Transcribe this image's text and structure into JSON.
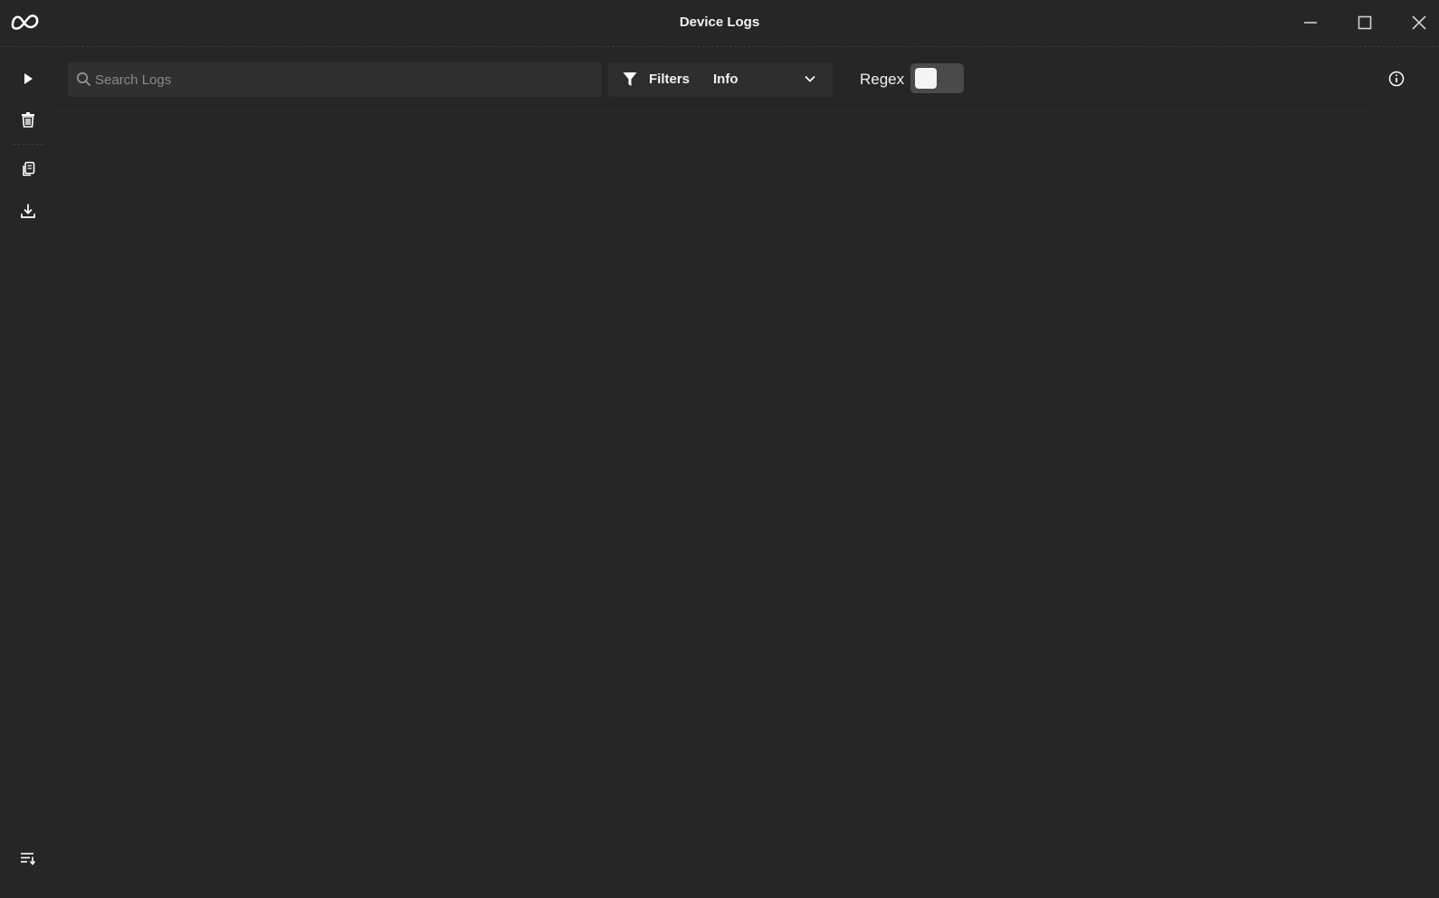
{
  "window": {
    "title": "Device Logs",
    "logo_icon": "meta-logo",
    "controls": [
      "minimize-icon",
      "maximize-icon",
      "close-icon"
    ]
  },
  "sidebar": {
    "actions": [
      {
        "icon": "play-icon",
        "name": "start-logging"
      },
      {
        "icon": "trash-icon",
        "name": "clear-logs"
      },
      {
        "icon": "copy-icon",
        "name": "copy-logs"
      },
      {
        "icon": "download-icon",
        "name": "download-logs"
      }
    ],
    "bottom_action": {
      "icon": "scroll-to-bottom-icon",
      "name": "auto-scroll"
    }
  },
  "toolbar": {
    "search": {
      "placeholder": "Search Logs",
      "value": ""
    },
    "filters_label": "Filters",
    "level_select": {
      "value": "Info"
    },
    "regex_label": "Regex",
    "regex_enabled": false,
    "info_icon": "info-icon"
  },
  "log_entries": [],
  "colors": {
    "background": "#262626",
    "input_bg": "#303030",
    "toggle_bg": "#4a4a4a",
    "text": "#f0f0f0"
  }
}
